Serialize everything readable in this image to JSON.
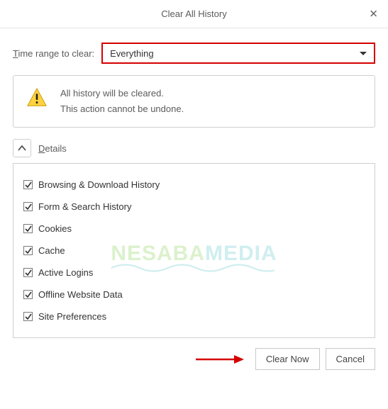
{
  "title": "Clear All History",
  "range": {
    "label_pre": "T",
    "label_rest": "ime range to clear:",
    "value": "Everything"
  },
  "warning": {
    "line1": "All history will be cleared.",
    "line2": "This action cannot be undone."
  },
  "details": {
    "label_pre": "D",
    "label_rest": "etails"
  },
  "items": [
    {
      "label": "Browsing & Download History",
      "checked": true
    },
    {
      "label": "Form & Search History",
      "checked": true
    },
    {
      "label": "Cookies",
      "checked": true
    },
    {
      "label": "Cache",
      "checked": true
    },
    {
      "label": "Active Logins",
      "checked": true
    },
    {
      "label": "Offline Website Data",
      "checked": true
    },
    {
      "label": "Site Preferences",
      "checked": true
    }
  ],
  "buttons": {
    "clear": "Clear Now",
    "cancel": "Cancel"
  },
  "watermark": {
    "a": "NESABA",
    "b": "MEDIA"
  }
}
